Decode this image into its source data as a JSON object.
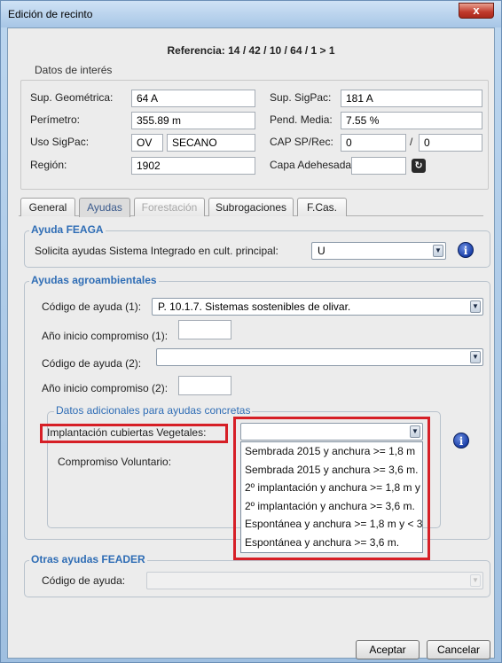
{
  "window": {
    "title": "Edición de recinto",
    "close_glyph": "x"
  },
  "header": {
    "referencia": "Referencia: 14 / 42 / 10 / 64 / 1 > 1"
  },
  "datos_interes": {
    "title": "Datos de interés",
    "sup_geometrica_label": "Sup. Geométrica:",
    "sup_geometrica_value": "64 A",
    "sup_sigpac_label": "Sup. SigPac:",
    "sup_sigpac_value": "181 A",
    "perimetro_label": "Perímetro:",
    "perimetro_value": "355.89 m",
    "pend_media_label": "Pend. Media:",
    "pend_media_value": "7.55 %",
    "uso_sigpac_label": "Uso SigPac:",
    "uso_sigpac_code": "OV",
    "uso_sigpac_desc": "SECANO",
    "cap_label": "CAP SP/Rec:",
    "cap_value1": "0",
    "cap_sep": "/",
    "cap_value2": "0",
    "region_label": "Región:",
    "region_value": "1902",
    "capa_label": "Capa Adehesada:",
    "capa_value": ""
  },
  "tabs": [
    {
      "label": "General",
      "state": "normal"
    },
    {
      "label": "Ayudas",
      "state": "active"
    },
    {
      "label": "Forestación",
      "state": "disabled"
    },
    {
      "label": "Subrogaciones",
      "state": "normal"
    },
    {
      "label": "F.Cas.",
      "state": "normal"
    }
  ],
  "ayuda_feaga": {
    "title": "Ayuda FEAGA",
    "solicita_label": "Solicita ayudas Sistema Integrado en cult. principal:",
    "solicita_value": "U"
  },
  "agroambientales": {
    "title": "Ayudas agroambientales",
    "codigo1_label": "Código de ayuda (1):",
    "codigo1_value": "P. 10.1.7. Sistemas sostenibles de olivar.",
    "anio1_label": "Año inicio compromiso (1):",
    "anio1_value": "",
    "codigo2_label": "Código de ayuda (2):",
    "codigo2_value": "",
    "anio2_label": "Año inicio compromiso (2):",
    "anio2_value": ""
  },
  "datos_adicionales": {
    "title": "Datos adicionales para ayudas concretas",
    "implantacion_label": "Implantación cubiertas Vegetales:",
    "compromiso_label": "Compromiso Voluntario:",
    "dropdown_options": [
      "Sembrada 2015 y anchura >= 1,8 m",
      "Sembrada 2015 y anchura >= 3,6 m.",
      "2º implantación y anchura >= 1,8 m y",
      "2º implantación y anchura >= 3,6 m.",
      "Espontánea y anchura >= 1,8 m y < 3",
      "Espontánea y anchura >= 3,6 m."
    ]
  },
  "otras_feader": {
    "title": "Otras ayudas FEADER",
    "codigo_label": "Código de ayuda:",
    "codigo_value": ""
  },
  "buttons": {
    "aceptar": "Aceptar",
    "cancelar": "Cancelar"
  },
  "icons": {
    "info": "i",
    "refresh": "↻",
    "combo_arrow": "▼"
  },
  "colors": {
    "highlight": "#d61f26",
    "group_title": "#2f6db5",
    "title_bar": "#bcd6ef"
  }
}
